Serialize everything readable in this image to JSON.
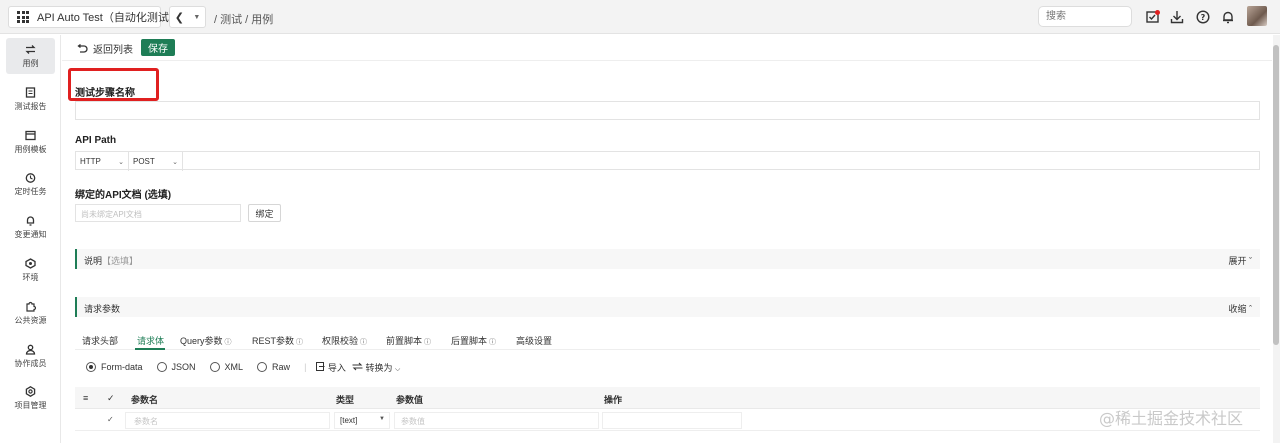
{
  "header": {
    "app_title": "API Auto Test（自动化测试）",
    "breadcrumb": "/ 测试 / 用例",
    "search_placeholder": "搜索"
  },
  "sidebar": {
    "items": [
      {
        "label": "用例",
        "icon": "swap-icon",
        "active": true
      },
      {
        "label": "测试报告",
        "icon": "report-icon"
      },
      {
        "label": "用例模板",
        "icon": "template-icon"
      },
      {
        "label": "定时任务",
        "icon": "clock-icon"
      },
      {
        "label": "变更通知",
        "icon": "bell-icon"
      },
      {
        "label": "环境",
        "icon": "environment-icon"
      },
      {
        "label": "公共资源",
        "icon": "puzzle-icon"
      },
      {
        "label": "协作成员",
        "icon": "members-icon"
      },
      {
        "label": "项目管理",
        "icon": "settings-icon"
      }
    ]
  },
  "toolbar": {
    "back_label": "返回列表",
    "save_label": "保存"
  },
  "form": {
    "step_name_label": "测试步骤名称",
    "step_name_value": "",
    "api_path_label": "API Path",
    "protocol": "HTTP",
    "method": "POST",
    "path_value": "",
    "bound_doc_label": "绑定的API文档 (选填)",
    "bound_doc_placeholder": "尚未绑定API文档",
    "bind_button": "绑定"
  },
  "description_section": {
    "title": "说明",
    "hint": "【选填】",
    "toggle": "展开"
  },
  "params_section": {
    "title": "请求参数",
    "toggle": "收缩"
  },
  "tabs": [
    {
      "label": "请求头部"
    },
    {
      "label": "请求体",
      "active": true
    },
    {
      "label": "Query参数"
    },
    {
      "label": "REST参数"
    },
    {
      "label": "权限校验"
    },
    {
      "label": "前置脚本"
    },
    {
      "label": "后置脚本"
    },
    {
      "label": "高级设置"
    }
  ],
  "body_type": {
    "options": [
      "Form-data",
      "JSON",
      "XML",
      "Raw"
    ],
    "selected": "Form-data",
    "import_label": "导入",
    "convert_label": "转换为"
  },
  "params_table": {
    "headers": [
      "参数名",
      "类型",
      "参数值",
      "操作"
    ],
    "row": {
      "name_placeholder": "参数名",
      "type": "[text]",
      "value_placeholder": "参数值"
    }
  },
  "watermark": "@稀土掘金技术社区",
  "colors": {
    "accent": "#1e7d56",
    "highlight": "#e02020"
  }
}
